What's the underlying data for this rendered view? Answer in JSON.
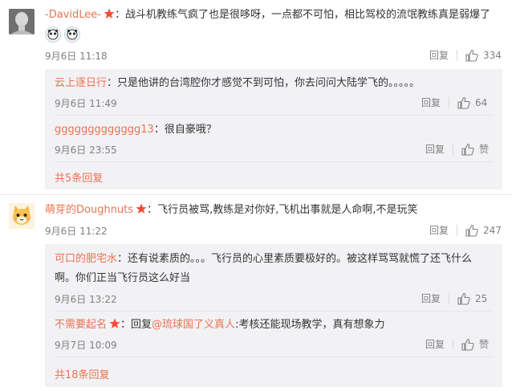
{
  "comments": [
    {
      "user": "-DavidLee-",
      "colon": "：",
      "text": "战斗机教练气疯了也是很哆呀，一点都不可怕，相比驾校的流氓教练真是弱爆了",
      "time": "9月6日 11:18",
      "reply_label": "回复",
      "like_count": "334",
      "replies": [
        {
          "user": "云上逐日行",
          "colon": "：",
          "text": "只是他讲的台湾腔你才感觉不到可怕，你去问问大陆学飞的。。。。。",
          "time": "9月6日 11:49",
          "reply_label": "回复",
          "like_count": "64"
        },
        {
          "user": "ggggggggggggg13",
          "colon": "：",
          "text": "很自豪哦？",
          "time": "9月6日 23:55",
          "reply_label": "回复",
          "like_count": "赞"
        }
      ],
      "more_replies": "共5条回复"
    },
    {
      "user": "萌芽的Doughnuts",
      "colon": "：",
      "text": "飞行员被骂,教练是对你好,飞机出事就是人命啊,不是玩笑",
      "time": "9月6日 11:22",
      "reply_label": "回复",
      "like_count": "247",
      "replies": [
        {
          "user": "可口的肥宅水",
          "colon": "：",
          "text_line1": "还有说素质的。。。飞行员的心里素质要极好的。被这样骂骂就慌了还飞什么",
          "text_line2": "啊。你们正当飞行员这么好当",
          "time": "9月6日 13:22",
          "reply_label": "回复",
          "like_count": "25"
        },
        {
          "user": "不需要起名",
          "colon": "：",
          "reply_prefix": "回复",
          "mention": "@琉球国了义真人",
          "text": ":考核还能现场教学，真有想象力",
          "time": "9月7日 10:09",
          "reply_label": "回复",
          "like_count": "赞"
        }
      ],
      "more_replies": "共18条回复"
    }
  ],
  "colors": {
    "username": "#eb7350",
    "text": "#333333",
    "meta": "#808080",
    "reply_bg": "#f2f2f5",
    "mention": "#eb7350"
  }
}
